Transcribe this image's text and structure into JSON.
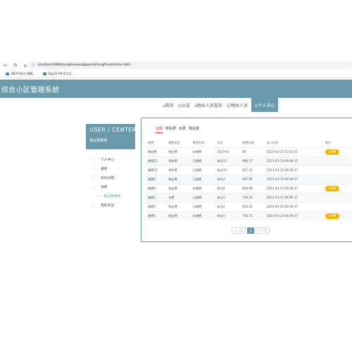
{
  "browser": {
    "url": "localhost:8080/zongheixiaoqiguanlisheng/front/index.html",
    "bookmarks": [
      "IDEA代码注 模板...",
      "Day03-09-员工分..."
    ]
  },
  "site": {
    "title": "综合小区管理系统"
  },
  "nav": {
    "items": [
      "⌂首页",
      "◎公告",
      "⌂物业人员投诉",
      "☺物业人员",
      "♙个人中心"
    ]
  },
  "sidebar": {
    "title": "USER / CENTER",
    "subtitle": "物业费缴纳",
    "items": [
      {
        "label": "个人中心",
        "sub": false
      },
      {
        "label": "报修",
        "sub": false
      },
      {
        "label": "车位分配",
        "sub": false
      },
      {
        "label": "资费",
        "sub": false
      },
      {
        "label": "物业费缴纳",
        "sub": true
      },
      {
        "label": "我的车位",
        "sub": false
      }
    ]
  },
  "tabs": [
    "全部",
    "停车费",
    "水费",
    "物业费"
  ],
  "table": {
    "headers": [
      "缴费",
      "缴费类型",
      "缴费状态",
      "车位",
      "缴费金额",
      "录入时间",
      "操作"
    ],
    "action_label": "缴费",
    "rows": [
      [
        "物业费",
        "物业费",
        "未缴费",
        "2023-01",
        "80",
        "2023-03-15 10:02:21",
        true
      ],
      [
        "缴费12",
        "停车费",
        "已缴费",
        "车位13",
        "988.37",
        "2023-03-15 09:06:31",
        false
      ],
      [
        "缴费12",
        "停车费",
        "已缴费",
        "车位13",
        "821.21",
        "2023-03-15 09:06:17",
        false
      ],
      [
        "缴费6",
        "物业费",
        "已缴费",
        "车位3",
        "907.92",
        "2023-03-15 09:06:17",
        false
      ],
      [
        "缴费8",
        "物业费",
        "未缴费",
        "车位8",
        "808.66",
        "2023-03-15 09:06:17",
        true
      ],
      [
        "缴费1",
        "水费",
        "已缴费",
        "车位1",
        "749.62",
        "2023-03-15 09:06:17",
        false
      ],
      [
        "缴费2",
        "物业费",
        "已缴费",
        "车位2",
        "854.91",
        "2023-03-15 09:06:17",
        false
      ],
      [
        "缴费1",
        "物业费",
        "未缴费",
        "车位1",
        "765.71",
        "2023-03-15 09:06:17",
        true
      ]
    ]
  },
  "pager": {
    "prev": "上一页",
    "current": "1",
    "next": "下一页"
  }
}
